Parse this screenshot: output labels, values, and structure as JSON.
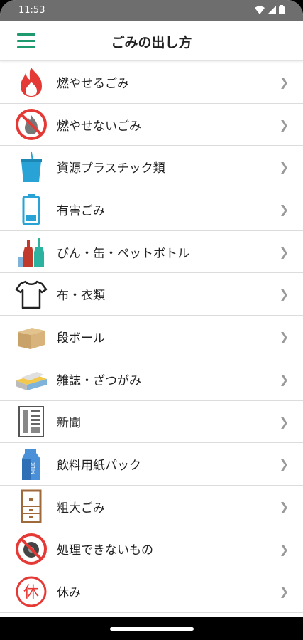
{
  "status": {
    "time": "11:53"
  },
  "header": {
    "title": "ごみの出し方"
  },
  "items": [
    {
      "label": "燃やせるごみ",
      "icon": "burnable-trash-icon"
    },
    {
      "label": "燃やせないごみ",
      "icon": "non-burnable-trash-icon"
    },
    {
      "label": "資源プラスチック類",
      "icon": "plastic-cup-icon"
    },
    {
      "label": "有害ごみ",
      "icon": "battery-icon"
    },
    {
      "label": "びん・缶・ペットボトル",
      "icon": "bottles-icon"
    },
    {
      "label": "布・衣類",
      "icon": "tshirt-icon"
    },
    {
      "label": "段ボール",
      "icon": "cardboard-box-icon"
    },
    {
      "label": "雑誌・ざつがみ",
      "icon": "magazines-icon"
    },
    {
      "label": "新聞",
      "icon": "newspaper-icon"
    },
    {
      "label": "飲料用紙パック",
      "icon": "milk-carton-icon"
    },
    {
      "label": "粗大ごみ",
      "icon": "furniture-icon"
    },
    {
      "label": "処理できないもの",
      "icon": "tire-prohibited-icon"
    },
    {
      "label": "休み",
      "icon": "holiday-icon"
    }
  ],
  "colors": {
    "accent": "#1e9a6e",
    "alert": "#e53935",
    "cyan": "#29a3d6"
  }
}
